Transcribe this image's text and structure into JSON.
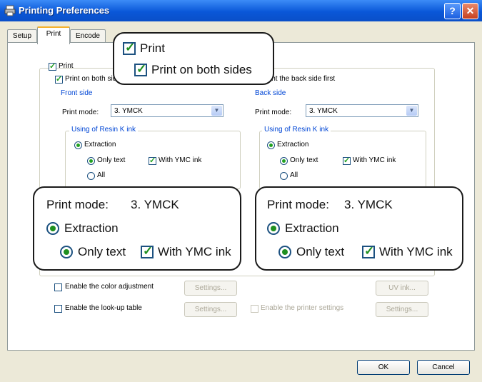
{
  "window": {
    "title": "Printing Preferences",
    "help_label": "?",
    "close_label": "✕"
  },
  "tabs": [
    {
      "label": "Setup"
    },
    {
      "label": "Print"
    },
    {
      "label": "Encode"
    }
  ],
  "print": {
    "label": "Print",
    "checked": true
  },
  "both_sides": {
    "label": "Print on both sides",
    "checked": true
  },
  "back_first": {
    "label": "Print the back side first",
    "checked": false
  },
  "front": {
    "title": "Front side",
    "mode_label": "Print mode:",
    "mode_value": "3. YMCK",
    "resin": {
      "title": "Using of Resin K ink",
      "extraction": "Extraction",
      "only_text": "Only text",
      "with_ymc": "With YMC ink",
      "all": "All"
    }
  },
  "back": {
    "title": "Back side",
    "mode_label": "Print mode:",
    "mode_value": "3. YMCK",
    "resin": {
      "title": "Using of Resin K ink",
      "extraction": "Extraction",
      "only_text": "Only text",
      "with_ymc": "With YMC ink",
      "all": "All"
    }
  },
  "color_adj": {
    "label": "Enable the color adjustment",
    "button": "Settings..."
  },
  "uv_button": "UV ink...",
  "lookup": {
    "label": "Enable the look-up table",
    "button": "Settings..."
  },
  "printer_settings": {
    "label": "Enable the printer settings",
    "button": "Settings..."
  },
  "footer": {
    "ok": "OK",
    "cancel": "Cancel"
  },
  "callouts": {
    "top": {
      "print": "Print",
      "both_sides": "Print on both sides"
    },
    "left": {
      "mode_label": "Print mode:",
      "mode_value": "3. YMCK",
      "extraction": "Extraction",
      "only_text": "Only text",
      "with_ymc": "With YMC ink"
    },
    "right": {
      "mode_label": "Print mode:",
      "mode_value": "3. YMCK",
      "extraction": "Extraction",
      "only_text": "Only text",
      "with_ymc": "With YMC ink"
    }
  },
  "colors": {
    "title_bar": "#0a57d8",
    "group_title": "#0046d5",
    "check_green": "#21a121"
  }
}
